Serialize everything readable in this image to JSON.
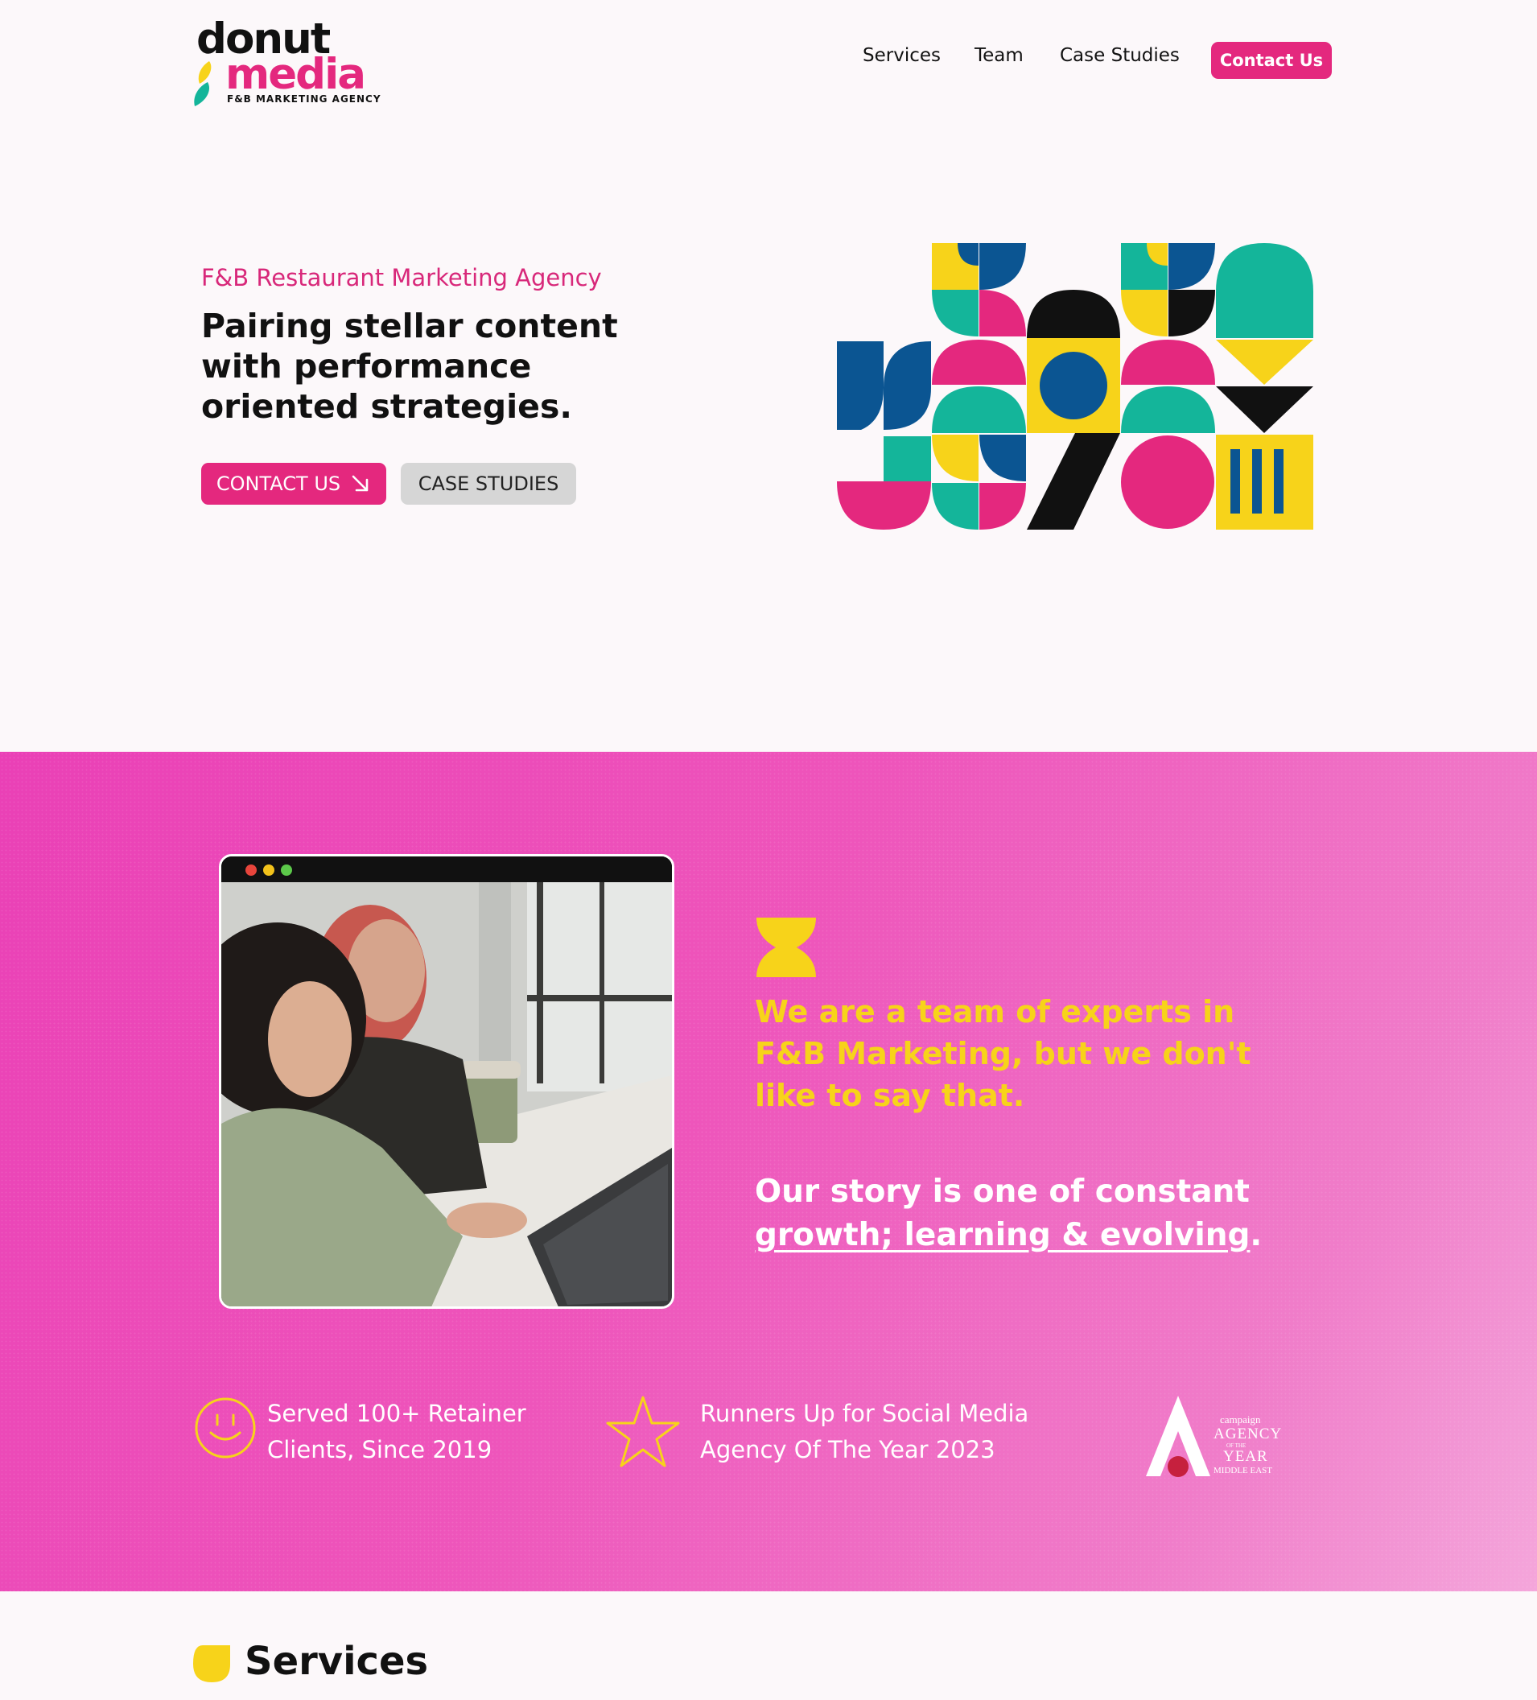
{
  "brand": {
    "name_line1": "donut",
    "name_line2": "media",
    "tagline": "F&B MARKETING AGENCY",
    "colors": {
      "pink": "#e4287e",
      "yellow": "#f7d31a",
      "teal": "#14b59a",
      "navy": "#0b5592",
      "black": "#111111"
    }
  },
  "nav": {
    "items": [
      {
        "label": "Services"
      },
      {
        "label": "Team"
      },
      {
        "label": "Case Studies"
      }
    ],
    "cta": "Contact Us"
  },
  "hero": {
    "eyebrow": "F&B Restaurant Marketing Agency",
    "title": "Pairing stellar content with performance oriented strategies.",
    "primary_cta": "CONTACT US",
    "primary_cta_icon": "arrow-down-right-icon",
    "secondary_cta": "CASE STUDIES"
  },
  "about": {
    "quote": "We are a team of experts in F&B Marketing, but we don't like to say that.",
    "story_prefix": "Our story is one of constant ",
    "story_link": "growth; learning & evolving",
    "story_suffix": ".",
    "stats": [
      {
        "icon": "smiley-icon",
        "text": "Served 100+ Retainer Clients, Since 2019"
      },
      {
        "icon": "star-icon",
        "text": "Runners Up for Social Media Agency Of The Year 2023"
      }
    ],
    "award": {
      "brand": "campaign",
      "line1": "AGENCY",
      "line2": "OF THE",
      "line3": "YEAR",
      "line4": "MIDDLE EAST"
    }
  },
  "services": {
    "title": "Services"
  }
}
